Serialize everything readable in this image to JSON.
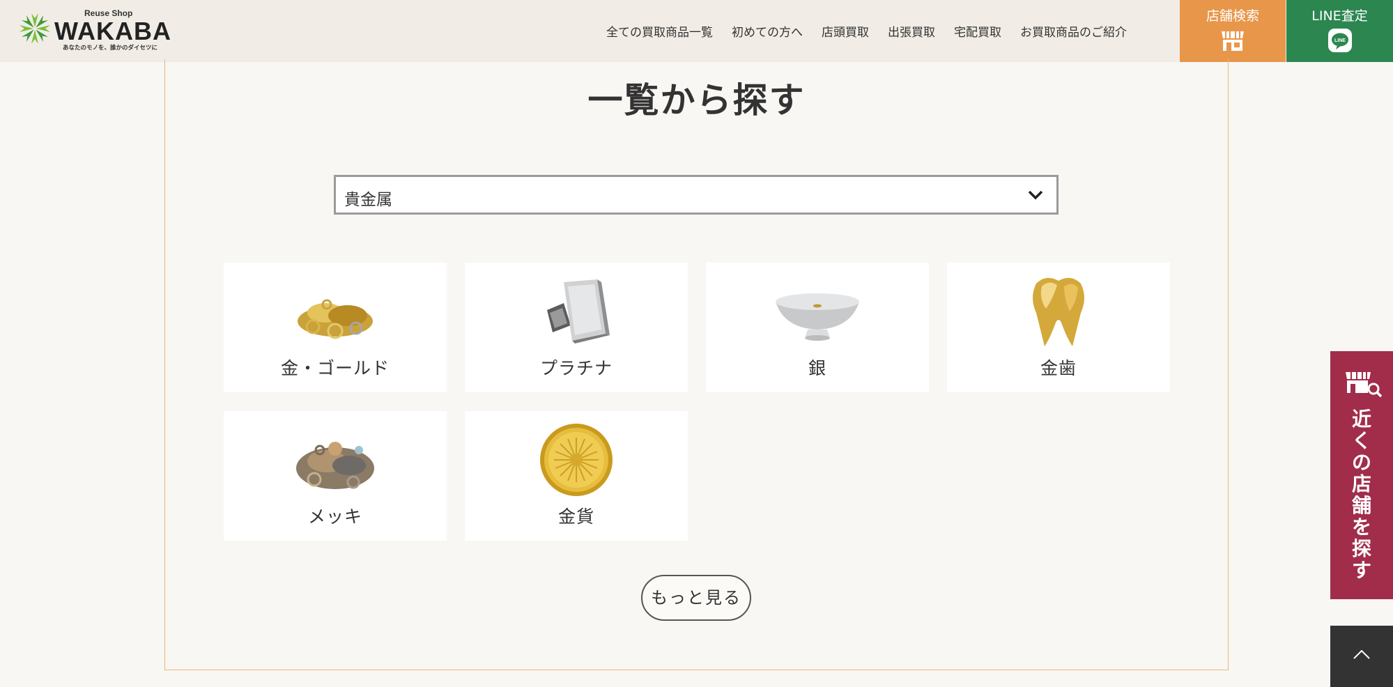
{
  "header": {
    "logo": {
      "sub": "Reuse Shop",
      "name": "WAKABA",
      "tagline": "あなたのモノを、誰かのダイセツに"
    },
    "nav": [
      "全ての買取商品一覧",
      "初めての方へ",
      "店頭買取",
      "出張買取",
      "宅配買取",
      "お買取商品のご紹介"
    ],
    "store_search_label": "店舗検索",
    "line_label": "LINE査定",
    "line_icon_text": "LINE"
  },
  "main": {
    "heading": "一覧から探す",
    "select_value": "貴金属",
    "items": [
      {
        "label": "金・ゴールド",
        "icon": "gold-jewelry-icon"
      },
      {
        "label": "プラチナ",
        "icon": "platinum-bar-icon"
      },
      {
        "label": "銀",
        "icon": "silver-cup-icon"
      },
      {
        "label": "金歯",
        "icon": "gold-tooth-icon"
      },
      {
        "label": "メッキ",
        "icon": "plated-jewelry-icon"
      },
      {
        "label": "金貨",
        "icon": "gold-coin-icon"
      }
    ],
    "more_label": "もっと見る"
  },
  "side_tab": {
    "label_lines": [
      "近",
      "く",
      "の",
      "店",
      "舗",
      "を",
      "探",
      "す"
    ]
  },
  "colors": {
    "header_bg": "#f1ede6",
    "store_button": "#e8964a",
    "line_button": "#2c8650",
    "side_tab": "#a12d4b",
    "frame_border": "#e6b57a"
  }
}
